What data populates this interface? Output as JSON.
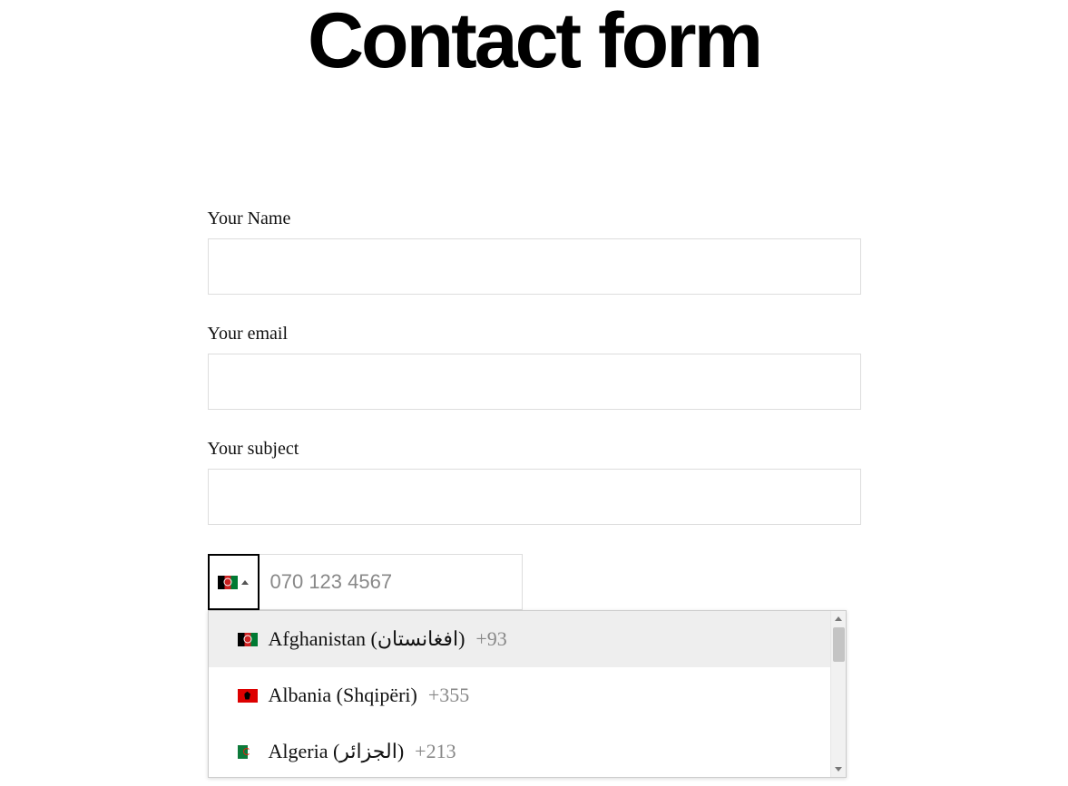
{
  "title": "Contact form",
  "form": {
    "name": {
      "label": "Your Name",
      "value": ""
    },
    "email": {
      "label": "Your email",
      "value": ""
    },
    "subject": {
      "label": "Your subject",
      "value": ""
    },
    "phone": {
      "placeholder": "070 123 4567",
      "value": "",
      "selected_country_flag": "af",
      "countries": [
        {
          "flag": "af",
          "name": "Afghanistan (افغانستان)",
          "dial": "+93",
          "active": true
        },
        {
          "flag": "al",
          "name": "Albania (Shqipëri)",
          "dial": "+355",
          "active": false
        },
        {
          "flag": "dz",
          "name": "Algeria (الجزائر)",
          "dial": "+213",
          "active": false
        }
      ]
    }
  }
}
